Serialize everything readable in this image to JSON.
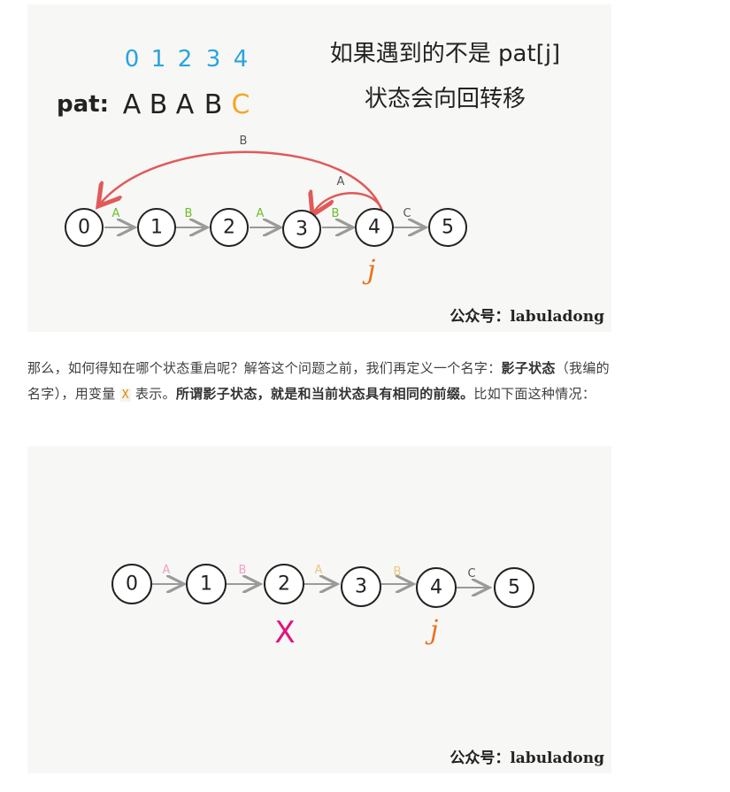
{
  "figure1": {
    "indices": [
      "0",
      "1",
      "2",
      "3",
      "4"
    ],
    "pat_label": "pat:",
    "pat_chars": [
      "A",
      "B",
      "A",
      "B",
      "C"
    ],
    "title_line1": "如果遇到的不是 pat[j]",
    "title_line2": "状态会向回转移",
    "nodes": [
      "0",
      "1",
      "2",
      "3",
      "4",
      "5"
    ],
    "edge_labels": [
      "A",
      "B",
      "A",
      "B",
      "C"
    ],
    "back_edge_long_label": "B",
    "back_edge_short_label": "A",
    "pointer_label": "j",
    "watermark": "公众号：labuladong"
  },
  "paragraph": {
    "s1": "那么，如何得知在哪个状态重启呢？解答这个问题之前，我们再定义一个名字：",
    "b1": "影子状态",
    "s2": "（我编的名字），用变量",
    "code": "X",
    "s3": "表示。",
    "b2": "所谓影子状态，就是和当前状态具有相同的前缀。",
    "s4": "比如下面这种情况："
  },
  "figure2": {
    "nodes": [
      "0",
      "1",
      "2",
      "3",
      "4",
      "5"
    ],
    "edge_labels": [
      "A",
      "B",
      "A",
      "B",
      "C"
    ],
    "shadow_label": "X",
    "pointer_label": "j",
    "watermark": "公众号：labuladong"
  },
  "colors": {
    "index_blue": "#2aa3e0",
    "highlight_orange": "#f5a623",
    "edge_green": "#6cbf2a",
    "back_edge_red": "#e05a5a",
    "pointer_orange": "#e8721c",
    "shadow_magenta": "#e0147c",
    "edge_pink": "#f0a0c8",
    "edge_tan": "#e8c880"
  }
}
